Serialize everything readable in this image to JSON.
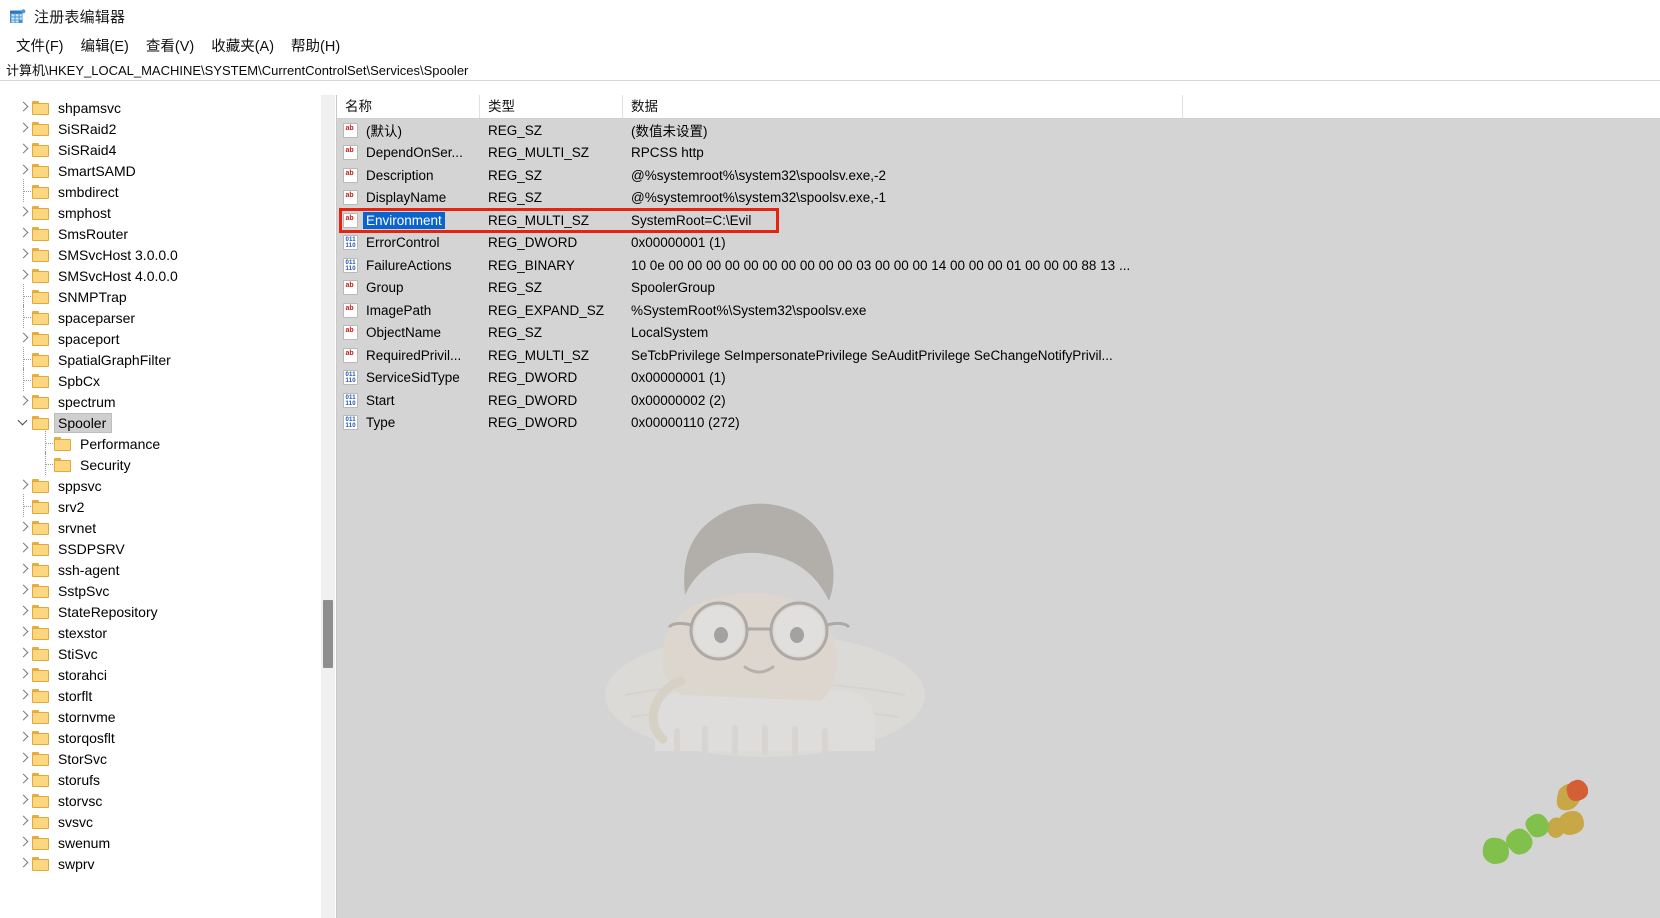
{
  "window": {
    "title": "注册表编辑器",
    "icon": "registry-editor-icon"
  },
  "menubar": {
    "items": [
      {
        "label": "文件(F)",
        "name": "menu-file"
      },
      {
        "label": "编辑(E)",
        "name": "menu-edit"
      },
      {
        "label": "查看(V)",
        "name": "menu-view"
      },
      {
        "label": "收藏夹(A)",
        "name": "menu-favorites"
      },
      {
        "label": "帮助(H)",
        "name": "menu-help"
      }
    ]
  },
  "addressbar": {
    "path": "计算机\\HKEY_LOCAL_MACHINE\\SYSTEM\\CurrentControlSet\\Services\\Spooler"
  },
  "tree": {
    "items": [
      {
        "label": "shpamsvc",
        "indent": 1,
        "state": "collapsed"
      },
      {
        "label": "SiSRaid2",
        "indent": 1,
        "state": "collapsed"
      },
      {
        "label": "SiSRaid4",
        "indent": 1,
        "state": "collapsed"
      },
      {
        "label": "SmartSAMD",
        "indent": 1,
        "state": "collapsed"
      },
      {
        "label": "smbdirect",
        "indent": 1,
        "state": "leaf"
      },
      {
        "label": "smphost",
        "indent": 1,
        "state": "collapsed"
      },
      {
        "label": "SmsRouter",
        "indent": 1,
        "state": "collapsed"
      },
      {
        "label": "SMSvcHost 3.0.0.0",
        "indent": 1,
        "state": "collapsed"
      },
      {
        "label": "SMSvcHost 4.0.0.0",
        "indent": 1,
        "state": "collapsed"
      },
      {
        "label": "SNMPTrap",
        "indent": 1,
        "state": "leaf"
      },
      {
        "label": "spaceparser",
        "indent": 1,
        "state": "leaf"
      },
      {
        "label": "spaceport",
        "indent": 1,
        "state": "collapsed"
      },
      {
        "label": "SpatialGraphFilter",
        "indent": 1,
        "state": "leaf"
      },
      {
        "label": "SpbCx",
        "indent": 1,
        "state": "leaf"
      },
      {
        "label": "spectrum",
        "indent": 1,
        "state": "collapsed"
      },
      {
        "label": "Spooler",
        "indent": 1,
        "state": "expanded",
        "selected": true
      },
      {
        "label": "Performance",
        "indent": 2,
        "state": "leaf"
      },
      {
        "label": "Security",
        "indent": 2,
        "state": "leaf"
      },
      {
        "label": "sppsvc",
        "indent": 1,
        "state": "collapsed"
      },
      {
        "label": "srv2",
        "indent": 1,
        "state": "leaf"
      },
      {
        "label": "srvnet",
        "indent": 1,
        "state": "collapsed"
      },
      {
        "label": "SSDPSRV",
        "indent": 1,
        "state": "collapsed"
      },
      {
        "label": "ssh-agent",
        "indent": 1,
        "state": "collapsed"
      },
      {
        "label": "SstpSvc",
        "indent": 1,
        "state": "collapsed"
      },
      {
        "label": "StateRepository",
        "indent": 1,
        "state": "collapsed"
      },
      {
        "label": "stexstor",
        "indent": 1,
        "state": "collapsed"
      },
      {
        "label": "StiSvc",
        "indent": 1,
        "state": "collapsed"
      },
      {
        "label": "storahci",
        "indent": 1,
        "state": "collapsed"
      },
      {
        "label": "storflt",
        "indent": 1,
        "state": "collapsed"
      },
      {
        "label": "stornvme",
        "indent": 1,
        "state": "collapsed"
      },
      {
        "label": "storqosflt",
        "indent": 1,
        "state": "collapsed"
      },
      {
        "label": "StorSvc",
        "indent": 1,
        "state": "collapsed"
      },
      {
        "label": "storufs",
        "indent": 1,
        "state": "collapsed"
      },
      {
        "label": "storvsc",
        "indent": 1,
        "state": "collapsed"
      },
      {
        "label": "svsvc",
        "indent": 1,
        "state": "collapsed"
      },
      {
        "label": "swenum",
        "indent": 1,
        "state": "collapsed"
      },
      {
        "label": "swprv",
        "indent": 1,
        "state": "collapsed"
      }
    ]
  },
  "values": {
    "columns": [
      {
        "label": "名称",
        "name": "column-name"
      },
      {
        "label": "类型",
        "name": "column-type"
      },
      {
        "label": "数据",
        "name": "column-data"
      }
    ],
    "rows": [
      {
        "name": "(默认)",
        "icon": "string",
        "type": "REG_SZ",
        "data": "(数值未设置)"
      },
      {
        "name": "DependOnSer...",
        "icon": "string",
        "type": "REG_MULTI_SZ",
        "data": "RPCSS http"
      },
      {
        "name": "Description",
        "icon": "string",
        "type": "REG_SZ",
        "data": "@%systemroot%\\system32\\spoolsv.exe,-2"
      },
      {
        "name": "DisplayName",
        "icon": "string",
        "type": "REG_SZ",
        "data": "@%systemroot%\\system32\\spoolsv.exe,-1"
      },
      {
        "name": "Environment",
        "icon": "string",
        "type": "REG_MULTI_SZ",
        "data": "SystemRoot=C:\\Evil",
        "selected": true,
        "highlighted": true
      },
      {
        "name": "ErrorControl",
        "icon": "binary",
        "type": "REG_DWORD",
        "data": "0x00000001 (1)"
      },
      {
        "name": "FailureActions",
        "icon": "binary",
        "type": "REG_BINARY",
        "data": "10 0e 00 00 00 00 00 00 00 00 00 00 03 00 00 00 14 00 00 00 01 00 00 00 88 13 ..."
      },
      {
        "name": "Group",
        "icon": "string",
        "type": "REG_SZ",
        "data": "SpoolerGroup"
      },
      {
        "name": "ImagePath",
        "icon": "string",
        "type": "REG_EXPAND_SZ",
        "data": "%SystemRoot%\\System32\\spoolsv.exe"
      },
      {
        "name": "ObjectName",
        "icon": "string",
        "type": "REG_SZ",
        "data": "LocalSystem"
      },
      {
        "name": "RequiredPrivil...",
        "icon": "string",
        "type": "REG_MULTI_SZ",
        "data": "SeTcbPrivilege SeImpersonatePrivilege SeAuditPrivilege SeChangeNotifyPrivil..."
      },
      {
        "name": "ServiceSidType",
        "icon": "binary",
        "type": "REG_DWORD",
        "data": "0x00000001 (1)"
      },
      {
        "name": "Start",
        "icon": "binary",
        "type": "REG_DWORD",
        "data": "0x00000002 (2)"
      },
      {
        "name": "Type",
        "icon": "binary",
        "type": "REG_DWORD",
        "data": "0x00000110 (272)"
      }
    ]
  },
  "annotation": {
    "type": "red-rectangle",
    "color": "#e8220f",
    "target_row": "Environment"
  },
  "colors": {
    "selection_blue": "#0b63ce",
    "tree_selection_gray": "#cfcfcf",
    "value_pane_bg": "#d4d4d4",
    "folder_yellow": "#fcd77f",
    "annotation_red": "#e8220f"
  }
}
